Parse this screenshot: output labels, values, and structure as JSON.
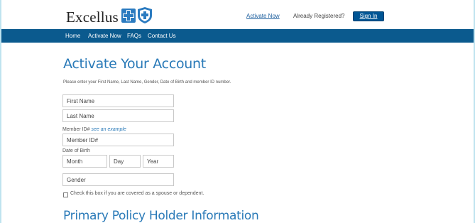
{
  "header": {
    "logo_text": "Excellus",
    "links": {
      "activate_now": "Activate Now",
      "already_registered": "Already Registered?",
      "sign_in": "Sign In"
    },
    "brand_color": "#0b5a8e"
  },
  "nav": {
    "items": [
      "Home",
      "Activate Now",
      "FAQs",
      "Contact Us"
    ]
  },
  "main": {
    "title": "Activate Your Account",
    "instructions": "Please enter your First Name, Last Name, Gender, Date of Birth and member ID number.",
    "fields": {
      "first_name": {
        "placeholder": "First Name",
        "value": ""
      },
      "last_name": {
        "placeholder": "Last Name",
        "value": ""
      },
      "member_id_label": "Member ID#",
      "member_id_example": "see an example",
      "member_id": {
        "placeholder": "Member ID#",
        "value": ""
      },
      "dob_label": "Date of Birth",
      "month": {
        "placeholder": "Month",
        "value": ""
      },
      "day": {
        "placeholder": "Day",
        "value": ""
      },
      "year": {
        "placeholder": "Year",
        "value": ""
      },
      "gender": {
        "selected": "Gender"
      }
    },
    "spouse_checkbox": {
      "checked": false,
      "label": "Check this box if you are covered as a spouse or dependent."
    },
    "section_title": "Primary Policy Holder Information"
  }
}
